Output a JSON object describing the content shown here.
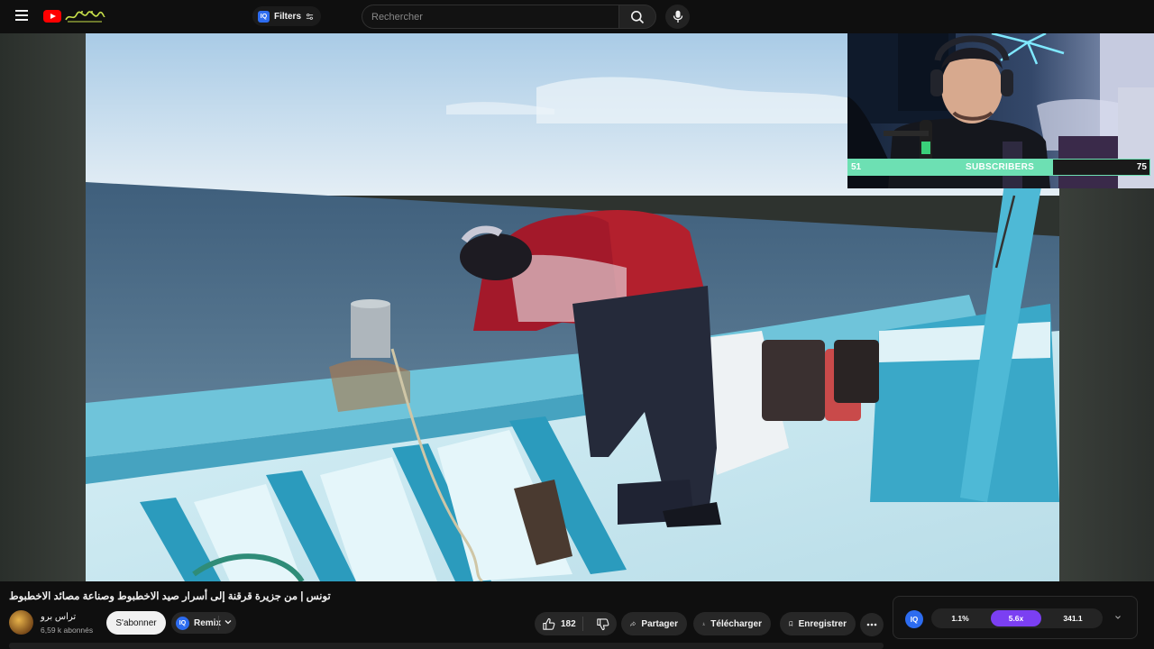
{
  "header": {
    "filters_label": "Filters",
    "iq_badge": "IQ",
    "search_placeholder": "Rechercher"
  },
  "overlay": {
    "subscriber_goal": {
      "current": "51",
      "label": "SUBSCRIBERS",
      "goal": "75",
      "fill_fraction": 0.68,
      "color": "#6de0b3"
    }
  },
  "video": {
    "title": "تونس | من جزيرة قرقنة إلى أسرار صيد الاخطبوط وصناعة مصائد الاخطبوط"
  },
  "channel": {
    "name": "تراس برو",
    "subscribers": "6,59 k abonnés"
  },
  "actions": {
    "subscribe": "S'abonner",
    "remix": "Remix",
    "likes": "182",
    "share": "Partager",
    "download": "Télécharger",
    "save": "Enregistrer"
  },
  "speed_panel": {
    "iq": "IQ",
    "options": [
      "1.1%",
      "5.6x",
      "341.1"
    ],
    "selected_index": 1,
    "accent": "#7b3ff2"
  },
  "colors": {
    "youtube_red": "#ff0000",
    "accent_blue": "#2d6cf0"
  }
}
